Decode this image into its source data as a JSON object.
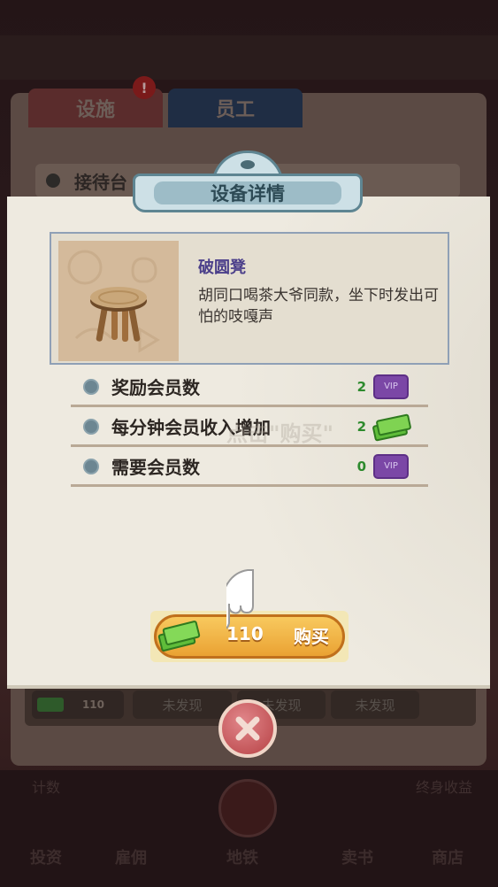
{
  "background": {
    "tabs": [
      "设施",
      "员工"
    ],
    "badge": "!",
    "row_label": "接待台",
    "cash_value": "110",
    "slots": [
      "未发现",
      "未发现",
      "未发现"
    ],
    "nav_labels": [
      "投资",
      "雇佣",
      "地铁",
      "卖书",
      "商店"
    ],
    "left_label": "计数",
    "right_label": "终身收益"
  },
  "dialog": {
    "title": "设备详情",
    "item": {
      "name": "破圆凳",
      "description": "胡同口喝茶大爷同款，坐下时发出可怕的吱嘎声",
      "image_icon": "stool-icon"
    },
    "stats": [
      {
        "label": "奖励会员数",
        "value": "2",
        "icon": "vip-icon",
        "icon_text": "VIP"
      },
      {
        "label": "每分钟会员收入增加",
        "value": "2",
        "icon": "cash-icon"
      },
      {
        "label": "需要会员数",
        "value": "0",
        "icon": "vip-icon",
        "icon_text": "VIP"
      }
    ],
    "watermark": "点击\"购买\"",
    "buy": {
      "price": "110",
      "label": "购买"
    }
  },
  "colors": {
    "title_plate": "#cde0e6",
    "buy_button": "#eaa233",
    "close_button": "#b74245",
    "stat_value": "#2d8a2d",
    "vip": "#7b47a6"
  }
}
